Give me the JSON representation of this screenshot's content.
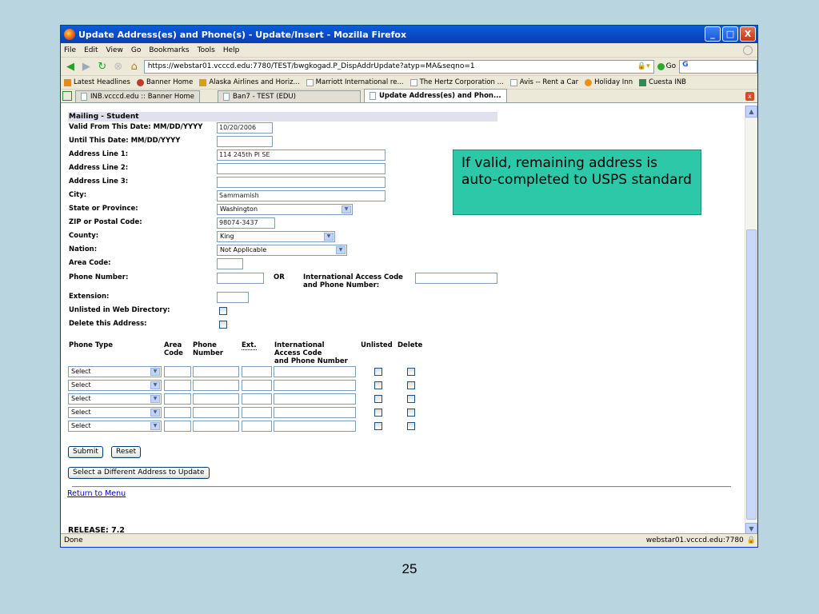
{
  "window": {
    "title": "Update Address(es) and Phone(s) - Update/Insert - Mozilla Firefox",
    "controls": [
      "_",
      "□",
      "X"
    ]
  },
  "menu": [
    "File",
    "Edit",
    "View",
    "Go",
    "Bookmarks",
    "Tools",
    "Help"
  ],
  "nav": {
    "url": "https://webstar01.vcccd.edu:7780/TEST/bwgkogad.P_DispAddrUpdate?atyp=MA&seqno=1",
    "go_label": "Go",
    "search_value": "G"
  },
  "bookmarks": [
    "Latest Headlines",
    "Banner Home",
    "Alaska Airlines and Horiz...",
    "Marriott International re...",
    "The Hertz Corporation ...",
    "Avis -- Rent a Car",
    "Holiday Inn",
    "Cuesta INB"
  ],
  "tabs": [
    "INB.vcccd.edu :: Banner Home",
    "Ban7 - TEST (EDU)",
    "Update Address(es) and Phon..."
  ],
  "form": {
    "header": "Mailing - Student",
    "valid_from_label": "Valid From This Date: MM/DD/YYYY",
    "valid_from_value": "10/20/2006",
    "until_label": "Until This Date: MM/DD/YYYY",
    "until_value": "",
    "addr1_label": "Address Line 1:",
    "addr1_value": "114 245th Pl SE",
    "addr2_label": "Address Line 2:",
    "addr3_label": "Address Line 3:",
    "city_label": "City:",
    "city_value": "Sammamish",
    "state_label": "State or Province:",
    "state_value": "Washington",
    "zip_label": "ZIP or Postal Code:",
    "zip_value": "98074-3437",
    "county_label": "County:",
    "county_value": "King",
    "nation_label": "Nation:",
    "nation_value": "Not Applicable",
    "area_label": "Area Code:",
    "phone_label": "Phone Number:",
    "or_label": "OR",
    "intl_label_1": "International Access Code",
    "intl_label_2": "and Phone Number:",
    "ext_label": "Extension:",
    "unlisted_label": "Unlisted in Web Directory:",
    "delete_label": "Delete this Address:"
  },
  "phone_table": {
    "headers": {
      "type": "Phone Type",
      "area": [
        "Area",
        "Code"
      ],
      "phone": [
        "Phone",
        "Number"
      ],
      "ext": "Ext.",
      "intl": [
        "International",
        "Access Code",
        "and Phone Number"
      ],
      "unlisted": "Unlisted",
      "delete": "Delete"
    },
    "rows": [
      "Select",
      "Select",
      "Select",
      "Select",
      "Select"
    ]
  },
  "buttons": {
    "submit": "Submit",
    "reset": "Reset",
    "select_different": "Select a Different Address to Update"
  },
  "return_link": "Return to Menu",
  "release": "RELEASE: 7.2",
  "status": {
    "left": "Done",
    "right": "webstar01.vcccd.edu:7780"
  },
  "callout": "If valid, remaining address is auto-completed to USPS standard",
  "slide_number": "25"
}
